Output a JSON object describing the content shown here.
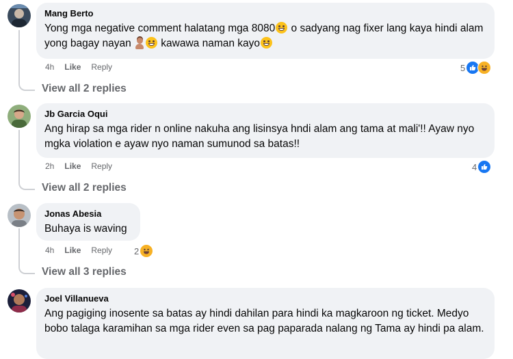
{
  "comments": [
    {
      "author": "Mang Berto",
      "text_parts": [
        "Yong mga negative comment halatang mga 8080",
        " o sadyang nag fixer lang kaya hindi alam yong bagay nayan ",
        " kawawa naman kayo"
      ],
      "time": "4h",
      "like_label": "Like",
      "reply_label": "Reply",
      "reaction_count": "5",
      "reactions": [
        "like-icon",
        "haha-icon"
      ],
      "view_replies": "View all 2 replies"
    },
    {
      "author": "Jb Garcia Oqui",
      "text": "Ang hirap sa mga rider n online nakuha ang lisinsya hndi alam ang tama at mali'!! Ayaw nyo mgka violation e ayaw nyo naman sumunod sa batas!!",
      "time": "2h",
      "like_label": "Like",
      "reply_label": "Reply",
      "reaction_count": "4",
      "reactions": [
        "like-icon"
      ],
      "view_replies": "View all 2 replies"
    },
    {
      "author": "Jonas Abesia",
      "text": "Buhaya is waving",
      "time": "4h",
      "like_label": "Like",
      "reply_label": "Reply",
      "reaction_count": "2",
      "reactions": [
        "haha-icon"
      ],
      "view_replies": "View all 3 replies"
    },
    {
      "author": "Joel Villanueva",
      "text": "Ang pagiging inosente sa batas ay hindi dahilan para hindi ka magkaroon ng ticket. Medyo bobo talaga karamihan sa mga rider even sa pag paparada nalang ng Tama ay hindi pa alam."
    }
  ],
  "colors": {
    "bubble": "#f0f2f5",
    "meta_text": "#65676b",
    "like_blue": "#1877f2",
    "haha_yellow": "#f7b125"
  }
}
